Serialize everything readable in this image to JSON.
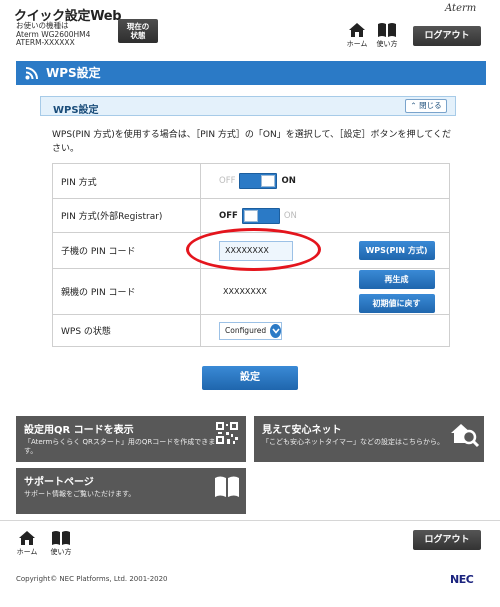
{
  "header": {
    "app_title": "クイック設定Web",
    "device_label": "お使いの機種は",
    "device_model": "Aterm WG2600HM4",
    "device_id": "ATERM-XXXXXX",
    "status_button_line1": "現在の",
    "status_button_line2": "状態",
    "brand": "Aterm",
    "home_label": "ホーム",
    "help_label": "使い方",
    "logout_label": "ログアウト"
  },
  "title_bar": {
    "title": "WPS設定"
  },
  "panel": {
    "title": "WPS設定",
    "close_label": "閉じる",
    "description": "WPS(PIN 方式)を使用する場合は、［PIN 方式］の「ON」を選択して、［設定］ボタンを押してください。"
  },
  "rows": {
    "pin_method": {
      "label": "PIN 方式",
      "off": "OFF",
      "on": "ON",
      "state": "ON"
    },
    "pin_method_ext": {
      "label": "PIN 方式(外部Registrar)",
      "off": "OFF",
      "on": "ON",
      "state": "OFF"
    },
    "child_pin": {
      "label": "子機の PIN コード",
      "value": "XXXXXXXX",
      "button": "WPS(PIN 方式)"
    },
    "parent_pin": {
      "label": "親機の PIN コード",
      "value": "XXXXXXXX",
      "regen_button": "再生成",
      "reset_button": "初期値に戻す"
    },
    "wps_status": {
      "label": "WPS の状態",
      "value": "Configured"
    }
  },
  "submit_label": "設定",
  "tiles": {
    "qr": {
      "title": "設定用QR コードを表示",
      "desc_line1": "「Atermらくらく QRスタート」用のQRコードを作成できま",
      "desc_line2": "す。"
    },
    "safety": {
      "title": "見えて安心ネット",
      "desc": "「こども安心ネットタイマー」などの設定はこちらから。"
    },
    "support": {
      "title": "サポートページ",
      "desc": "サポート情報をご覧いただけます。"
    }
  },
  "footer": {
    "home_label": "ホーム",
    "help_label": "使い方",
    "logout_label": "ログアウト",
    "copyright": "Copyright© NEC Platforms, Ltd. 2001-2020",
    "nec_logo": "NEC"
  },
  "colors": {
    "accent": "#2b7ac6",
    "tile": "#585858",
    "highlight": "#e4151d"
  }
}
